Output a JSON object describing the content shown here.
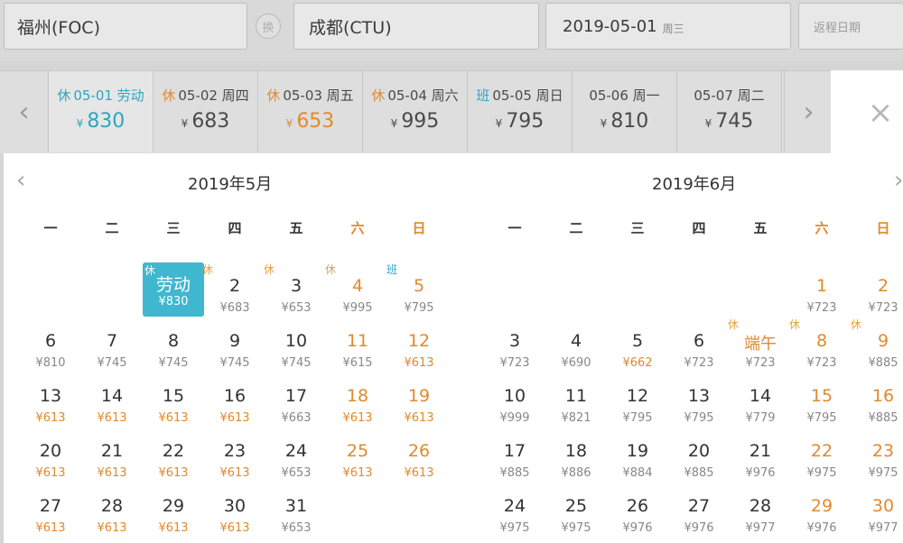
{
  "search": {
    "from": "福州(FOC)",
    "to": "成都(CTU)",
    "date": "2019-05-01",
    "date_dow": "周三",
    "return_placeholder": "返程日期",
    "swap_label": "换"
  },
  "date_strip": {
    "prev_icon": "chevron-left-icon",
    "next_icon": "chevron-right-icon",
    "currency": "¥",
    "items": [
      {
        "tag": "休",
        "date": "05-01",
        "day": "劳动",
        "price": "830",
        "color": "teal"
      },
      {
        "tag": "休",
        "date": "05-02",
        "day": "周四",
        "price": "683",
        "color": "normal"
      },
      {
        "tag": "休",
        "date": "05-03",
        "day": "周五",
        "price": "653",
        "color": "orange"
      },
      {
        "tag": "休",
        "date": "05-04",
        "day": "周六",
        "price": "995",
        "color": "normal"
      },
      {
        "tag": "班",
        "date": "05-05",
        "day": "周日",
        "price": "795",
        "color": "normal"
      },
      {
        "tag": "",
        "date": "05-06",
        "day": "周一",
        "price": "810",
        "color": "normal"
      },
      {
        "tag": "",
        "date": "05-07",
        "day": "周二",
        "price": "745",
        "color": "normal"
      }
    ]
  },
  "close_label": "×",
  "calendar": {
    "prev_icon": "chevron-left-icon",
    "next_icon": "chevron-right-icon",
    "weekdays": [
      "一",
      "二",
      "三",
      "四",
      "五",
      "六",
      "日"
    ],
    "months": [
      {
        "title": "2019年5月",
        "days": [
          {
            "col": 2,
            "row": 0,
            "num": "劳动",
            "price": "¥830",
            "hol": "休",
            "selected": true
          },
          {
            "col": 3,
            "row": 0,
            "num": "2",
            "price": "¥683",
            "hol": "休"
          },
          {
            "col": 4,
            "row": 0,
            "num": "3",
            "price": "¥653",
            "hol": "休"
          },
          {
            "col": 5,
            "row": 0,
            "num": "4",
            "price": "¥995",
            "hol": "休"
          },
          {
            "col": 6,
            "row": 0,
            "num": "5",
            "price": "¥795",
            "hol": "班"
          },
          {
            "col": 0,
            "row": 1,
            "num": "6",
            "price": "¥810"
          },
          {
            "col": 1,
            "row": 1,
            "num": "7",
            "price": "¥745"
          },
          {
            "col": 2,
            "row": 1,
            "num": "8",
            "price": "¥745"
          },
          {
            "col": 3,
            "row": 1,
            "num": "9",
            "price": "¥745"
          },
          {
            "col": 4,
            "row": 1,
            "num": "10",
            "price": "¥745"
          },
          {
            "col": 5,
            "row": 1,
            "num": "11",
            "price": "¥615"
          },
          {
            "col": 6,
            "row": 1,
            "num": "12",
            "price": "¥613",
            "cheap": true
          },
          {
            "col": 0,
            "row": 2,
            "num": "13",
            "price": "¥613",
            "cheap": true
          },
          {
            "col": 1,
            "row": 2,
            "num": "14",
            "price": "¥613",
            "cheap": true
          },
          {
            "col": 2,
            "row": 2,
            "num": "15",
            "price": "¥613",
            "cheap": true
          },
          {
            "col": 3,
            "row": 2,
            "num": "16",
            "price": "¥613",
            "cheap": true
          },
          {
            "col": 4,
            "row": 2,
            "num": "17",
            "price": "¥663"
          },
          {
            "col": 5,
            "row": 2,
            "num": "18",
            "price": "¥613",
            "cheap": true
          },
          {
            "col": 6,
            "row": 2,
            "num": "19",
            "price": "¥613",
            "cheap": true
          },
          {
            "col": 0,
            "row": 3,
            "num": "20",
            "price": "¥613",
            "cheap": true
          },
          {
            "col": 1,
            "row": 3,
            "num": "21",
            "price": "¥613",
            "cheap": true
          },
          {
            "col": 2,
            "row": 3,
            "num": "22",
            "price": "¥613",
            "cheap": true
          },
          {
            "col": 3,
            "row": 3,
            "num": "23",
            "price": "¥613",
            "cheap": true
          },
          {
            "col": 4,
            "row": 3,
            "num": "24",
            "price": "¥653"
          },
          {
            "col": 5,
            "row": 3,
            "num": "25",
            "price": "¥613",
            "cheap": true
          },
          {
            "col": 6,
            "row": 3,
            "num": "26",
            "price": "¥613",
            "cheap": true
          },
          {
            "col": 0,
            "row": 4,
            "num": "27",
            "price": "¥613",
            "cheap": true
          },
          {
            "col": 1,
            "row": 4,
            "num": "28",
            "price": "¥613",
            "cheap": true
          },
          {
            "col": 2,
            "row": 4,
            "num": "29",
            "price": "¥613",
            "cheap": true
          },
          {
            "col": 3,
            "row": 4,
            "num": "30",
            "price": "¥613",
            "cheap": true
          },
          {
            "col": 4,
            "row": 4,
            "num": "31",
            "price": "¥653"
          }
        ]
      },
      {
        "title": "2019年6月",
        "days": [
          {
            "col": 5,
            "row": 0,
            "num": "1",
            "price": "¥723"
          },
          {
            "col": 6,
            "row": 0,
            "num": "2",
            "price": "¥723"
          },
          {
            "col": 0,
            "row": 1,
            "num": "3",
            "price": "¥723"
          },
          {
            "col": 1,
            "row": 1,
            "num": "4",
            "price": "¥690"
          },
          {
            "col": 2,
            "row": 1,
            "num": "5",
            "price": "¥662",
            "cheap": true
          },
          {
            "col": 3,
            "row": 1,
            "num": "6",
            "price": "¥723"
          },
          {
            "col": 4,
            "row": 1,
            "num": "端午",
            "price": "¥723",
            "hol": "休",
            "fest": true
          },
          {
            "col": 5,
            "row": 1,
            "num": "8",
            "price": "¥723",
            "hol": "休"
          },
          {
            "col": 6,
            "row": 1,
            "num": "9",
            "price": "¥885",
            "hol": "休"
          },
          {
            "col": 0,
            "row": 2,
            "num": "10",
            "price": "¥999"
          },
          {
            "col": 1,
            "row": 2,
            "num": "11",
            "price": "¥821"
          },
          {
            "col": 2,
            "row": 2,
            "num": "12",
            "price": "¥795"
          },
          {
            "col": 3,
            "row": 2,
            "num": "13",
            "price": "¥795"
          },
          {
            "col": 4,
            "row": 2,
            "num": "14",
            "price": "¥779"
          },
          {
            "col": 5,
            "row": 2,
            "num": "15",
            "price": "¥795"
          },
          {
            "col": 6,
            "row": 2,
            "num": "16",
            "price": "¥885"
          },
          {
            "col": 0,
            "row": 3,
            "num": "17",
            "price": "¥885"
          },
          {
            "col": 1,
            "row": 3,
            "num": "18",
            "price": "¥886"
          },
          {
            "col": 2,
            "row": 3,
            "num": "19",
            "price": "¥884"
          },
          {
            "col": 3,
            "row": 3,
            "num": "20",
            "price": "¥885"
          },
          {
            "col": 4,
            "row": 3,
            "num": "21",
            "price": "¥976"
          },
          {
            "col": 5,
            "row": 3,
            "num": "22",
            "price": "¥975"
          },
          {
            "col": 6,
            "row": 3,
            "num": "23",
            "price": "¥975"
          },
          {
            "col": 0,
            "row": 4,
            "num": "24",
            "price": "¥975"
          },
          {
            "col": 1,
            "row": 4,
            "num": "25",
            "price": "¥975"
          },
          {
            "col": 2,
            "row": 4,
            "num": "26",
            "price": "¥976"
          },
          {
            "col": 3,
            "row": 4,
            "num": "27",
            "price": "¥976"
          },
          {
            "col": 4,
            "row": 4,
            "num": "28",
            "price": "¥977"
          },
          {
            "col": 5,
            "row": 4,
            "num": "29",
            "price": "¥976"
          },
          {
            "col": 6,
            "row": 4,
            "num": "30",
            "price": "¥977"
          }
        ]
      }
    ]
  }
}
